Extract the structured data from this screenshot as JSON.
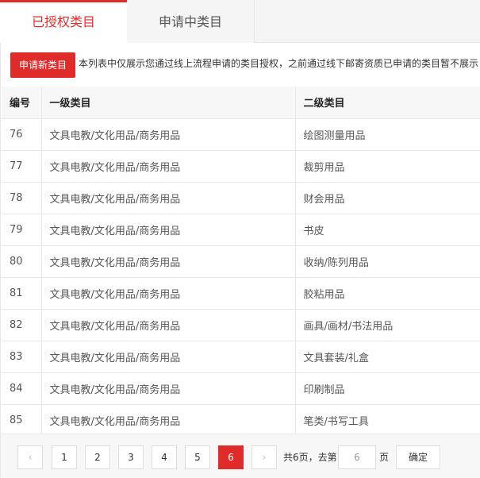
{
  "tabs": [
    {
      "label": "已授权类目",
      "active": true
    },
    {
      "label": "申请中类目",
      "active": false
    }
  ],
  "toolbar": {
    "apply_label": "申请新类目",
    "notice": "本列表中仅展示您通过线上流程申请的类目授权，之前通过线下邮寄资质已申请的类目暂不展示，"
  },
  "table": {
    "headers": [
      "编号",
      "一级类目",
      "二级类目"
    ],
    "rows": [
      {
        "id": "76",
        "level1": "文具电教/文化用品/商务用品",
        "level2": "绘图测量用品"
      },
      {
        "id": "77",
        "level1": "文具电教/文化用品/商务用品",
        "level2": "裁剪用品"
      },
      {
        "id": "78",
        "level1": "文具电教/文化用品/商务用品",
        "level2": "财会用品"
      },
      {
        "id": "79",
        "level1": "文具电教/文化用品/商务用品",
        "level2": "书皮"
      },
      {
        "id": "80",
        "level1": "文具电教/文化用品/商务用品",
        "level2": "收纳/陈列用品"
      },
      {
        "id": "81",
        "level1": "文具电教/文化用品/商务用品",
        "level2": "胶粘用品"
      },
      {
        "id": "82",
        "level1": "文具电教/文化用品/商务用品",
        "level2": "画具/画材/书法用品"
      },
      {
        "id": "83",
        "level1": "文具电教/文化用品/商务用品",
        "level2": "文具套装/礼盒"
      },
      {
        "id": "84",
        "level1": "文具电教/文化用品/商务用品",
        "level2": "印刷制品"
      },
      {
        "id": "85",
        "level1": "文具电教/文化用品/商务用品",
        "level2": "笔类/书写工具"
      }
    ]
  },
  "pager": {
    "prev": "‹",
    "next": "›",
    "pages": [
      "1",
      "2",
      "3",
      "4",
      "5",
      "6"
    ],
    "current": "6",
    "total_text": "共6页，去第",
    "goto_value": "6",
    "page_suffix": "页",
    "confirm_label": "确定"
  },
  "colors": {
    "accent": "#e02b2b",
    "header_bg": "#f7f7f7",
    "border": "#e8e8e8"
  }
}
